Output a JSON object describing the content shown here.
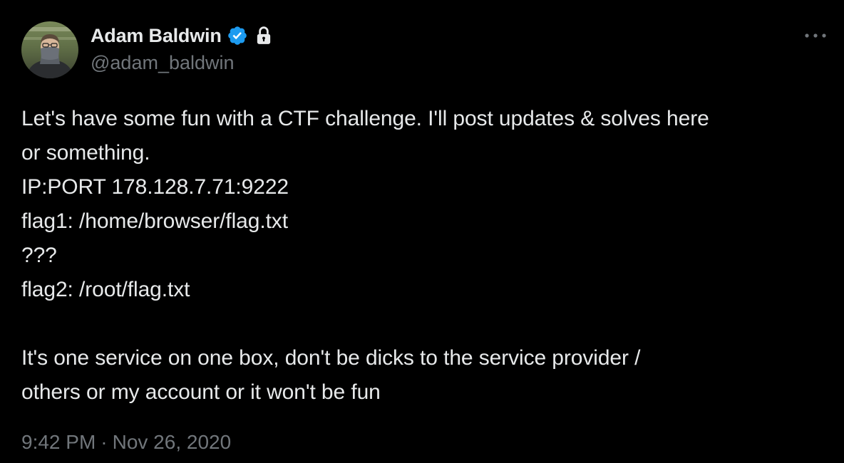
{
  "author": {
    "display_name": "Adam Baldwin",
    "handle": "@adam_baldwin",
    "avatar_icon": "user-avatar-photo",
    "verified_icon": "verified-badge-icon",
    "protected_icon": "lock-icon"
  },
  "more_icon": "more-horizontal-icon",
  "tweet": {
    "lines": [
      "Let's have some fun with a CTF challenge. I'll post updates & solves here",
      "or something.",
      "IP:PORT 178.128.7.71:9222",
      "flag1: /home/browser/flag.txt",
      "???",
      "flag2: /root/flag.txt",
      "",
      "It's one service on one box, don't be dicks to the service provider /",
      "others or my account or it won't be fun"
    ]
  },
  "meta": {
    "time": "9:42 PM",
    "separator": "·",
    "date": "Nov 26, 2020"
  },
  "colors": {
    "background": "#000000",
    "primary_text": "#e7e9ea",
    "secondary_text": "#71767b",
    "verified_blue": "#1d9bf0"
  }
}
